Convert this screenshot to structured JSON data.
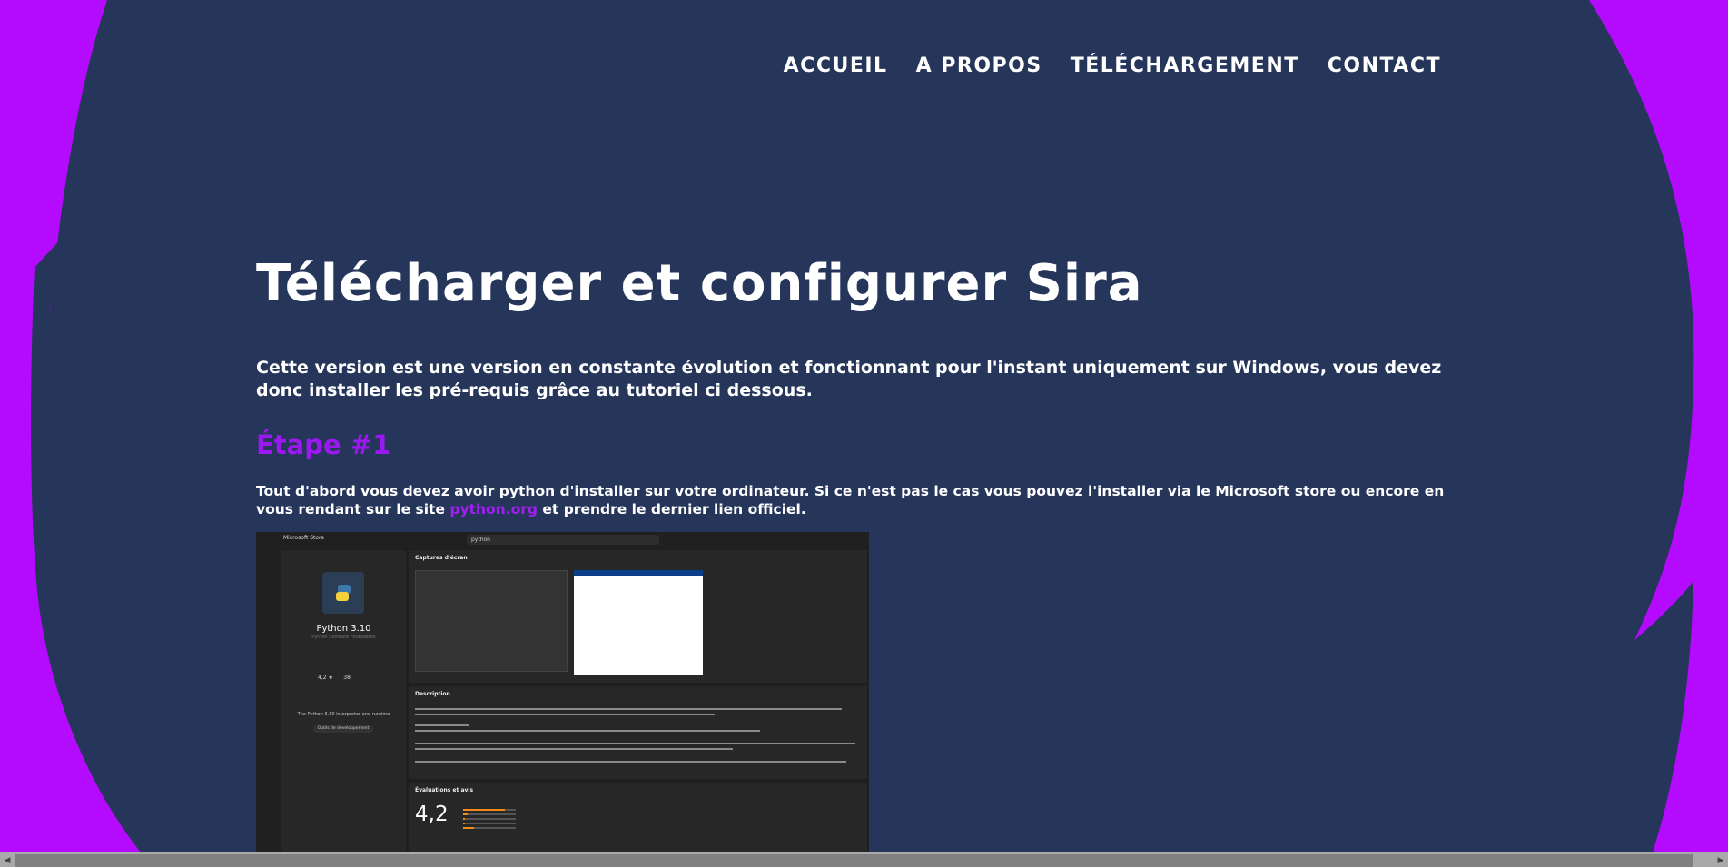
{
  "nav": {
    "items": [
      "ACCUEIL",
      "A PROPOS",
      "TÉLÉCHARGEMENT",
      "CONTACT"
    ]
  },
  "page": {
    "title": "Télécharger et configurer Sira",
    "lead": "Cette version est une version en constante évolution et fonctionnant pour l'instant uniquement sur Windows, vous devez donc installer les pré-requis grâce au tutoriel ci dessous.",
    "step_title": "Étape #1",
    "step_text_before": "Tout d'abord vous devez avoir python d'installer sur votre ordinateur. Si ce n'est pas le cas vous pouvez l'installer via le Microsoft store ou encore en vous rendant sur le site ",
    "step_link": "python.org",
    "step_text_after": " et prendre le dernier lien officiel."
  },
  "screenshot": {
    "window_title": "Microsoft Store",
    "search_value": "python",
    "app_name": "Python 3.10",
    "publisher": "Python Software Foundation",
    "rating": "4,2 ★",
    "rating_count": "38",
    "app_description": "The Python 3.10 interpreter and runtime",
    "app_button": "Outils de développement",
    "captures_title": "Captures d'écran",
    "description_title": "Description",
    "reviews_title": "Évaluations et avis",
    "big_rating": "4,2",
    "rating_bars": [
      0.8,
      0.08,
      0.04,
      0.04,
      0.2
    ]
  },
  "colors": {
    "background": "#26355a",
    "accent": "#b40bff",
    "heading_purple": "#9b18f0"
  }
}
